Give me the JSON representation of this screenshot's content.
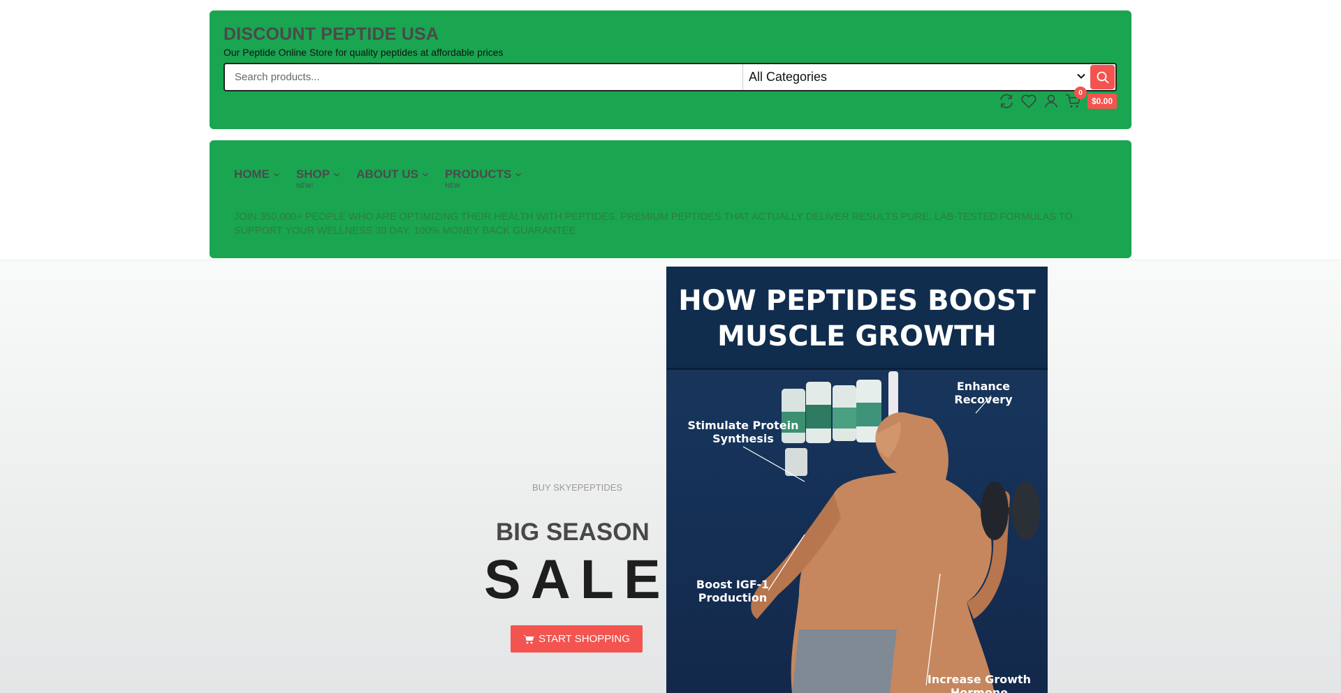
{
  "header": {
    "site_title": "DISCOUNT PEPTIDE USA",
    "tagline": "Our Peptide Online Store for quality peptides at affordable prices",
    "search_placeholder": "Search products...",
    "category_selected": "All Categories",
    "cart_count": "0",
    "cart_total": "$0.00",
    "icons": [
      "compare-icon",
      "wishlist-heart-icon",
      "account-user-icon",
      "cart-icon",
      "search-icon"
    ]
  },
  "nav": {
    "items": [
      {
        "label": "HOME",
        "badge": ""
      },
      {
        "label": "SHOP",
        "badge": "NEW!"
      },
      {
        "label": "ABOUT US",
        "badge": ""
      },
      {
        "label": "PRODUCTS",
        "badge": "NEW"
      }
    ],
    "promo_text": "JOIN 350,000+ PEOPLE WHO ARE OPTIMIZING THEIR HEALTH WITH PEPTIDES. PREMIUM PEPTIDES THAT ACTUALLY DELIVER RESULTS PURE, LAB-TESTED FORMULAS TO SUPPORT YOUR WELLNESS 30 DAY, 100% MONEY BACK GUARANTEE"
  },
  "hero": {
    "kicker": "BUY SKYEPEPTIDES",
    "title": "BIG SEASON",
    "sale": "SALE",
    "cta_label": "START SHOPPING",
    "cta_icon": "shopping-cart-icon"
  },
  "poster": {
    "title": "HOW PEPTIDES BOOST MUSCLE GROWTH",
    "labels": {
      "enhance_recovery": "Enhance Recovery",
      "stimulate": "Stimulate Protein Synthesis",
      "boost_igf": "Boost IGF-1 Production",
      "increase_gh": "Increase Growth Hormone"
    },
    "colors": {
      "background": "#16335a",
      "text": "#ffffff"
    }
  },
  "colors": {
    "brand_green": "#1aa551",
    "accent_red": "#f3544f",
    "nav_text": "#4b4b4b"
  }
}
